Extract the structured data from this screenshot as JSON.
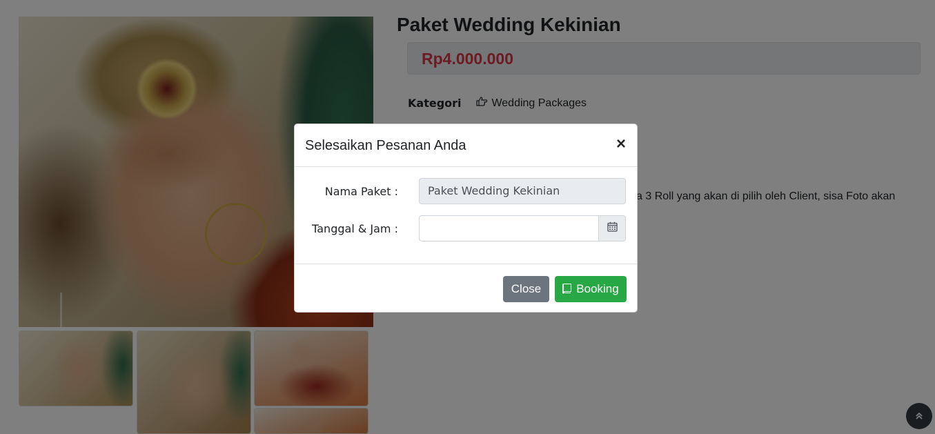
{
  "product": {
    "title": "Paket Wedding Kekinian",
    "price": "Rp4.000.000",
    "category_label": "Kategori",
    "category_value": "Wedding Packages",
    "description_partial": "a 3 Roll yang akan di pilih oleh Client, sisa Foto akan"
  },
  "modal": {
    "title": "Selesaikan Pesanan Anda",
    "close_symbol": "×",
    "fields": {
      "package_label": "Nama Paket :",
      "package_value": "Paket Wedding Kekinian",
      "datetime_label": "Tanggal & Jam :",
      "datetime_value": ""
    },
    "buttons": {
      "close": "Close",
      "booking": "Booking"
    }
  },
  "icons": {
    "category": "hand-pointing-right-icon",
    "calendar": "calendar-icon",
    "booking": "book-icon",
    "scroll_top": "double-chevron-up-icon"
  },
  "colors": {
    "price": "#dc3545",
    "booking_button": "#28a745",
    "close_button": "#6c757d",
    "scroll_top": "#343a40"
  }
}
